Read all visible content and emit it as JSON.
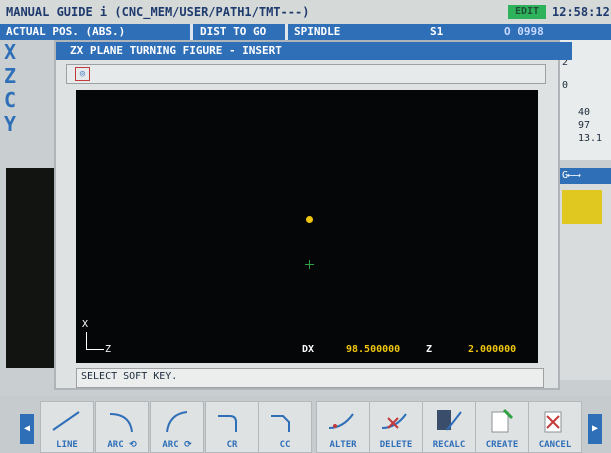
{
  "header": {
    "title": "MANUAL GUIDE i (CNC_MEM/USER/PATH1/TMT---)",
    "mode": "EDIT",
    "clock": "12:58:12"
  },
  "status_bar": {
    "actual_pos": "ACTUAL POS. (ABS.)",
    "dist_to_go": "DIST TO GO",
    "spindle": "SPINDLE",
    "spindle_no": "S1",
    "program": "O 0998"
  },
  "background": {
    "axes": [
      "X",
      "Z",
      "C",
      "Y"
    ],
    "right_values": [
      "2",
      "0",
      "40",
      "97",
      "13.1"
    ],
    "g_tab": "G⟵⟶"
  },
  "dialog": {
    "title": "ZX PLANE TURNING FIGURE - INSERT",
    "axis_x": "X",
    "axis_z": "Z",
    "dx_label": "DX",
    "dx_value": "98.500000",
    "z_label": "Z",
    "z_value": "2.000000",
    "message": "SELECT SOFT KEY."
  },
  "softkeys": [
    {
      "label": "LINE",
      "icon": "line-icon"
    },
    {
      "label": "ARC ⟲",
      "icon": "arc-cw-icon"
    },
    {
      "label": "ARC ⟳",
      "icon": "arc-ccw-icon"
    },
    {
      "label": "CR",
      "icon": "corner-radius-icon"
    },
    {
      "label": "CC",
      "icon": "corner-chamfer-icon"
    },
    {
      "label": "ALTER",
      "icon": "alter-icon"
    },
    {
      "label": "DELETE",
      "icon": "delete-icon"
    },
    {
      "label": "RECALC",
      "icon": "recalc-icon"
    },
    {
      "label": "CREATE",
      "icon": "create-icon"
    },
    {
      "label": "CANCEL",
      "icon": "cancel-icon"
    }
  ],
  "colors": {
    "accent_blue": "#2f6fb8",
    "edit_green": "#2fb25c",
    "value_yellow": "#f1c60e",
    "canvas_black": "#050608"
  }
}
